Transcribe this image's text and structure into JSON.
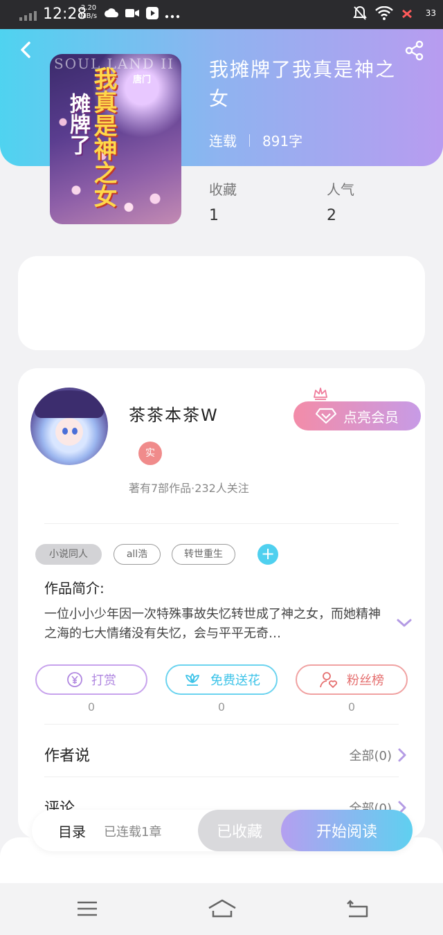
{
  "status_bar": {
    "time": "12:28",
    "speed_value": "2.20",
    "speed_unit": "MB/s",
    "battery": "33"
  },
  "book": {
    "title": "我摊牌了我真是神之女",
    "status": "连载",
    "word_count": "891字",
    "cover": {
      "brand": "SOUL LAND II",
      "title_line1": "我真是神之女",
      "title_line2": "摊牌了",
      "author": "唐门"
    }
  },
  "stats": {
    "favorites_label": "收藏",
    "favorites_value": "1",
    "popularity_label": "人气",
    "popularity_value": "2"
  },
  "author": {
    "name": "茶茶本茶W",
    "badge": "实",
    "info": "著有7部作品·232人关注",
    "vip_label": "点亮会员"
  },
  "tags": [
    "小说同人",
    "all浩",
    "转世重生"
  ],
  "tag_add": "+",
  "intro": {
    "title": "作品简介:",
    "text": "一位小小少年因一次特殊事故失忆转世成了神之女，而她精神之海的七大情绪没有失忆，会与平平无奇…"
  },
  "actions": [
    {
      "label": "打赏",
      "count": "0",
      "icon": "yen-icon"
    },
    {
      "label": "免费送花",
      "count": "0",
      "icon": "flower-icon"
    },
    {
      "label": "粉丝榜",
      "count": "0",
      "icon": "fan-icon"
    }
  ],
  "rows": {
    "author_says": "作者说",
    "author_says_right": "全部(0)",
    "comments": "评论",
    "comments_right": "全部(0)"
  },
  "bottom_bar": {
    "catalog": "目录",
    "chapters": "已连载1章",
    "collected": "已收藏",
    "start_reading": "开始阅读"
  },
  "colors": {
    "header_start": "#4fd3f0",
    "header_end": "#b89cf0",
    "vip_start": "#f38ca8",
    "vip_end": "#c79be6",
    "accent_cyan": "#4fd0ef"
  }
}
